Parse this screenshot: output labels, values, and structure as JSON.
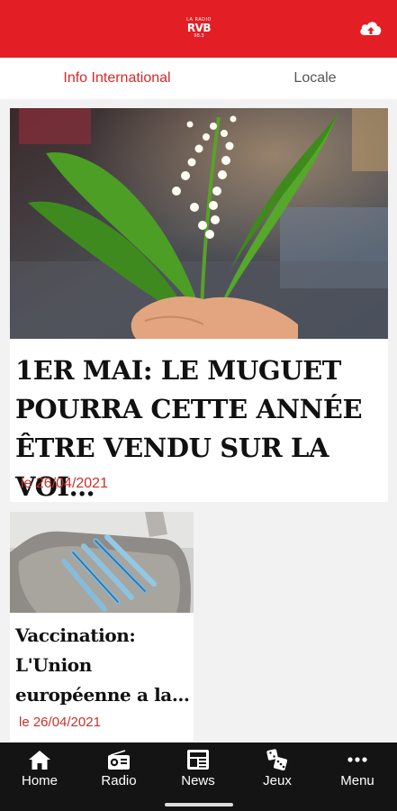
{
  "header": {
    "logo_top": "LA RADIO",
    "logo_main": "RVB",
    "logo_freq": "98.3",
    "upload_icon": "cloud-upload-icon"
  },
  "tabs": [
    {
      "label": "Info International",
      "active": true
    },
    {
      "label": "Locale",
      "active": false
    }
  ],
  "articles": [
    {
      "title": "1ER MAI: LE MUGUET POURRA CETTE ANNÉE ÊTRE VENDU SUR LA VOI…",
      "date": "le 26/04/2021",
      "image": "lily-of-the-valley-bouquet"
    },
    {
      "title": "Vaccination: L'Union européenne a la…",
      "date": "le 26/04/2021",
      "image": "vaccine-syringes-tray"
    }
  ],
  "nav": [
    {
      "label": "Home",
      "icon": "home-icon"
    },
    {
      "label": "Radio",
      "icon": "radio-icon"
    },
    {
      "label": "News",
      "icon": "news-icon"
    },
    {
      "label": "Jeux",
      "icon": "dice-icon"
    },
    {
      "label": "Menu",
      "icon": "more-dots-icon"
    }
  ],
  "colors": {
    "brand_red": "#e31e24",
    "date_red": "#c9302c",
    "nav_bg": "#141414"
  }
}
